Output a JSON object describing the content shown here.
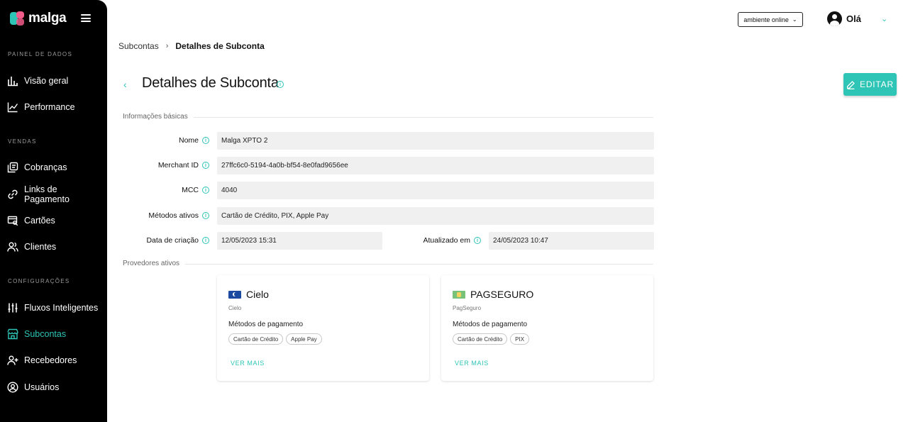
{
  "app": {
    "logo_text": "malga"
  },
  "sidebar": {
    "sections": [
      {
        "title": "PAINEL DE DADOS",
        "items": [
          {
            "label": "Visão geral",
            "icon": "bar-chart-icon"
          },
          {
            "label": "Performance",
            "icon": "line-chart-icon"
          }
        ]
      },
      {
        "title": "VENDAS",
        "items": [
          {
            "label": "Cobranças",
            "icon": "receipts-icon"
          },
          {
            "label": "Links de Pagamento",
            "icon": "link-icon"
          },
          {
            "label": "Cartões",
            "icon": "card-search-icon"
          },
          {
            "label": "Clientes",
            "icon": "users-icon"
          }
        ]
      },
      {
        "title": "CONFIGURAÇÕES",
        "items": [
          {
            "label": "Fluxos Inteligentes",
            "icon": "sliders-icon"
          },
          {
            "label": "Subcontas",
            "icon": "store-icon",
            "active": true
          },
          {
            "label": "Recebedores",
            "icon": "user-plus-icon"
          },
          {
            "label": "Usuários",
            "icon": "user-circle-icon"
          }
        ]
      }
    ]
  },
  "header": {
    "environment": "ambiente online",
    "greeting": "Olá"
  },
  "breadcrumb": {
    "parent": "Subcontas",
    "current": "Detalhes de Subconta"
  },
  "page": {
    "title": "Detalhes de Subconta",
    "edit_label": "EDITAR"
  },
  "basic_info": {
    "section_title": "Informações básicas",
    "fields": {
      "nome": {
        "label": "Nome",
        "value": "Malga XPTO 2"
      },
      "merchant_id": {
        "label": "Merchant ID",
        "value": "27ffc6c0-5194-4a0b-bf54-8e0fad9656ee"
      },
      "mcc": {
        "label": "MCC",
        "value": "4040"
      },
      "metodos": {
        "label": "Métodos ativos",
        "value": "Cartão de Crédito, PIX, Apple Pay"
      },
      "criacao": {
        "label": "Data de criação",
        "value": "12/05/2023 15:31"
      },
      "atualizado": {
        "label": "Atualizado em",
        "value": "24/05/2023 10:47"
      }
    }
  },
  "providers": {
    "section_title": "Provedores ativos",
    "methods_title": "Métodos de pagamento",
    "more_label": "VER MAIS",
    "items": [
      {
        "name": "Cielo",
        "sub": "Cielo",
        "flag_color": "#1b4aa0",
        "methods": [
          "Cartão de Crédito",
          "Apple Pay"
        ]
      },
      {
        "name": "PAGSEGURO",
        "sub": "PagSeguro",
        "flag_color": "#79c27a",
        "methods": [
          "Cartão de Crédito",
          "PIX"
        ]
      }
    ]
  },
  "colors": {
    "accent": "#2ec4b6",
    "sidebar_bg": "#000000",
    "field_bg": "#f0f0f0"
  }
}
